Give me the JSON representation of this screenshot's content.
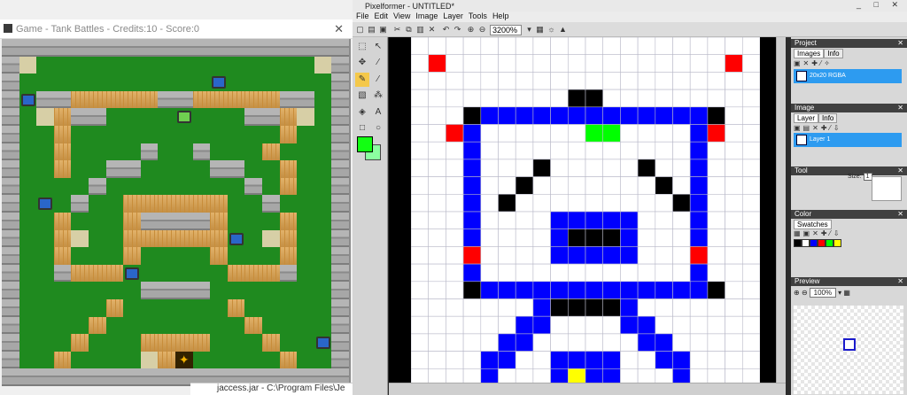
{
  "game": {
    "title": "Game - Tank Battles - Credits:10 - Score:0",
    "close_glyph": "✕"
  },
  "taskbar": {
    "item_text": "jaccess.jar - C:\\Program Files\\Je"
  },
  "pixelformer": {
    "title": "Pixelformer - UNTITLED*",
    "window_controls": [
      "_",
      "□",
      "✕"
    ],
    "menu": [
      "File",
      "Edit",
      "View",
      "Image",
      "Layer",
      "Tools",
      "Help"
    ],
    "zoom": "3200%",
    "foreground_color": "#12ff12",
    "background_color": "#8bffa0",
    "panels": {
      "project": {
        "title": "Project",
        "tabs": [
          "Images",
          "Info"
        ],
        "image_item": "20x20 RGBA"
      },
      "image": {
        "title": "Image",
        "tabs": [
          "Layer",
          "Info"
        ],
        "layer_item": "Layer 1"
      },
      "tool": {
        "title": "Tool",
        "size_label": "Size:",
        "size_value": "1"
      },
      "color": {
        "title": "Color",
        "tabs": [
          "Swatches"
        ],
        "swatches": [
          "#000000",
          "#ffffff",
          "#0000ff",
          "#ff0000",
          "#00ff00",
          "#ffff00"
        ]
      },
      "preview": {
        "title": "Preview",
        "zoom": "100%"
      }
    }
  },
  "pixel_art": {
    "width": 20,
    "height": 20,
    "palette": {
      "w": "#ffffff",
      "k": "#000000",
      "b": "#0000ff",
      "r": "#ff0000",
      "g": "#00ff00",
      "y": "#ffff00"
    },
    "rows": [
      "wwwwwwwwwwwwwwwwwwww",
      "wrwwwwwwwwwwwwwwwwrw",
      "wwwwwwwwwwwwwwwwwwww",
      "wwwwwwwwwkkwwwwwwwww",
      "wwwkbbbbbbbbbbbbbkww",
      "wwrbwwwwwwggwwwwbrww",
      "wwwbwwwwwwwwwwwwbwww",
      "wwwbwwwkwwwwwkwwbwww",
      "wwwbwwkwwwwwwwkwbwww",
      "wwwbwkwwwwwwwwwkbwww",
      "wwwbwwwwbbbbbwwwbwww",
      "wwwbwwwwbkkkbwwwbwww",
      "wwwrwwwwbbbbbwwwrwww",
      "wwwbwwwwwwwwwwwwbwww",
      "wwwkbbbbbbbbbbbbbkww",
      "wwwwwwwbkkkkbwwwwwww",
      "wwwwwwbbwwwwbbwwwwww",
      "wwwwwbbwwwwwwbbwwwww",
      "wwwwbbwwbbbbwwbbwwww",
      "wwwwbwwwbybbwwwbwwww"
    ]
  }
}
